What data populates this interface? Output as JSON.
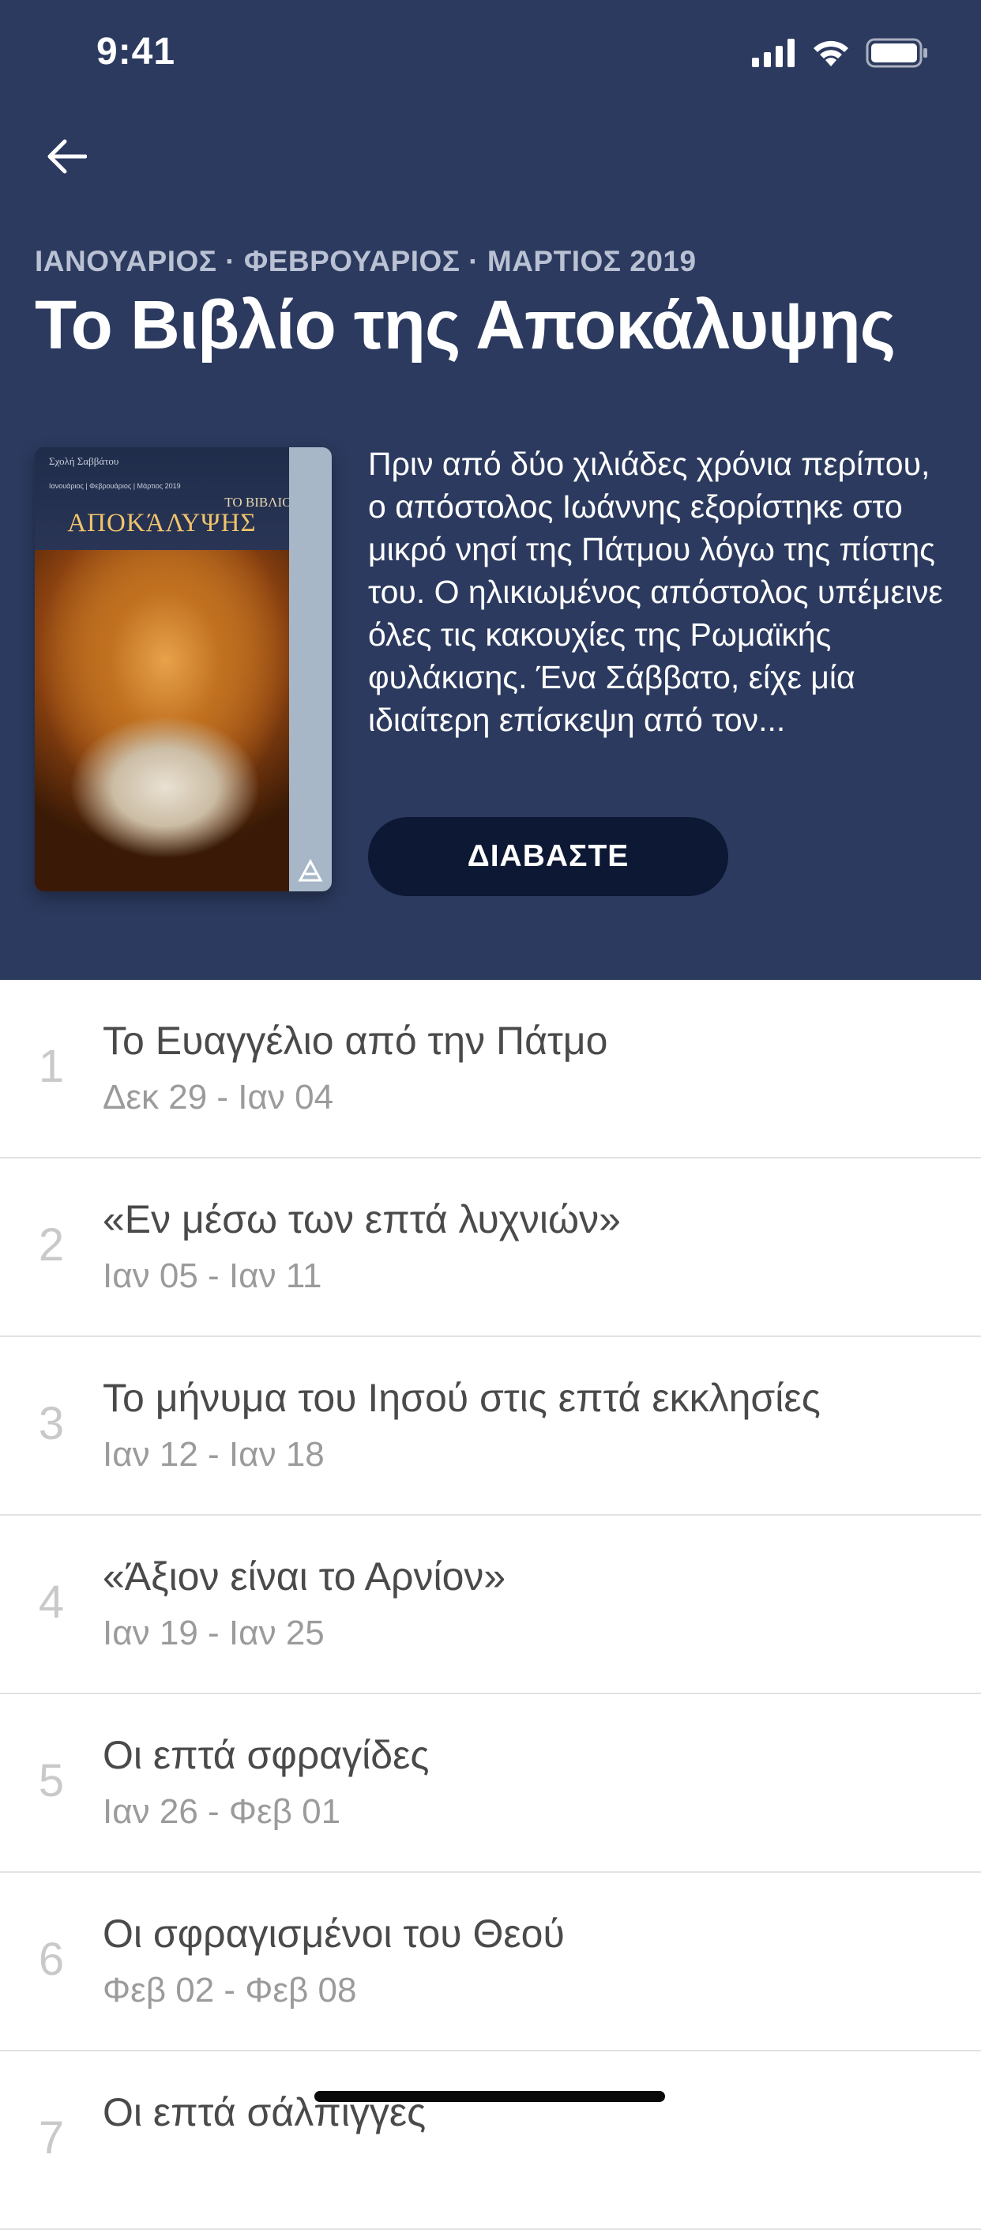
{
  "status_bar": {
    "time": "9:41",
    "icons": [
      "signal-icon",
      "wifi-icon",
      "battery-icon"
    ]
  },
  "header": {
    "back_icon": "arrow-left-icon",
    "quarter": "ΙΑΝΟΥΑΡΙΟΣ · ΦΕΒΡΟΥΑΡΙΟΣ · ΜΑΡΤΙΟΣ 2019",
    "title": "Το Βιβλίο της Αποκάλυψης",
    "background_color": "#2c3a5f"
  },
  "cover": {
    "school": "Σχολή Σαββάτου",
    "dates": "Ιανουάριος | Φεβρουάριος | Μάρτιος 2019",
    "subtitle": "ΤΟ ΒΙΒΛΙΟ ΤΗΣ",
    "title": "ΑΠΟΚΆΛΥΨΗΣ"
  },
  "description": "Πριν από δύο χιλιάδες χρόνια περίπου, ο απόστολος Ιωάννης εξορίστηκε στο μικρό νησί της Πάτμου λόγω της πίστης του. Ο ηλικιωμένος απόστολος υπέμεινε όλες τις κακουχίες της Ρωμαϊκής φυλάκισης. Ένα Σάββατο, είχε μία ιδιαίτερη επίσκεψη από τον...",
  "read_button": {
    "label": "ΔΙΑΒΑΣΤΕ",
    "color": "#0c1834"
  },
  "lessons": [
    {
      "number": "1",
      "title": "Το Ευαγγέλιο από την Πάτμο",
      "dates": "Δεκ 29 - Ιαν 04"
    },
    {
      "number": "2",
      "title": "«Εν μέσω των επτά λυχνιών»",
      "dates": "Ιαν 05 - Ιαν 11"
    },
    {
      "number": "3",
      "title": "Το μήνυμα του Ιησού στις επτά εκκλησίες",
      "dates": "Ιαν 12 - Ιαν 18"
    },
    {
      "number": "4",
      "title": "«Άξιον είναι το Αρνίον»",
      "dates": "Ιαν 19 - Ιαν 25"
    },
    {
      "number": "5",
      "title": "Οι επτά σφραγίδες",
      "dates": "Ιαν 26 - Φεβ 01"
    },
    {
      "number": "6",
      "title": "Οι σφραγισμένοι του Θεού",
      "dates": "Φεβ 02 - Φεβ 08"
    },
    {
      "number": "7",
      "title": "Οι επτά σάλπιγγες",
      "dates": ""
    }
  ]
}
